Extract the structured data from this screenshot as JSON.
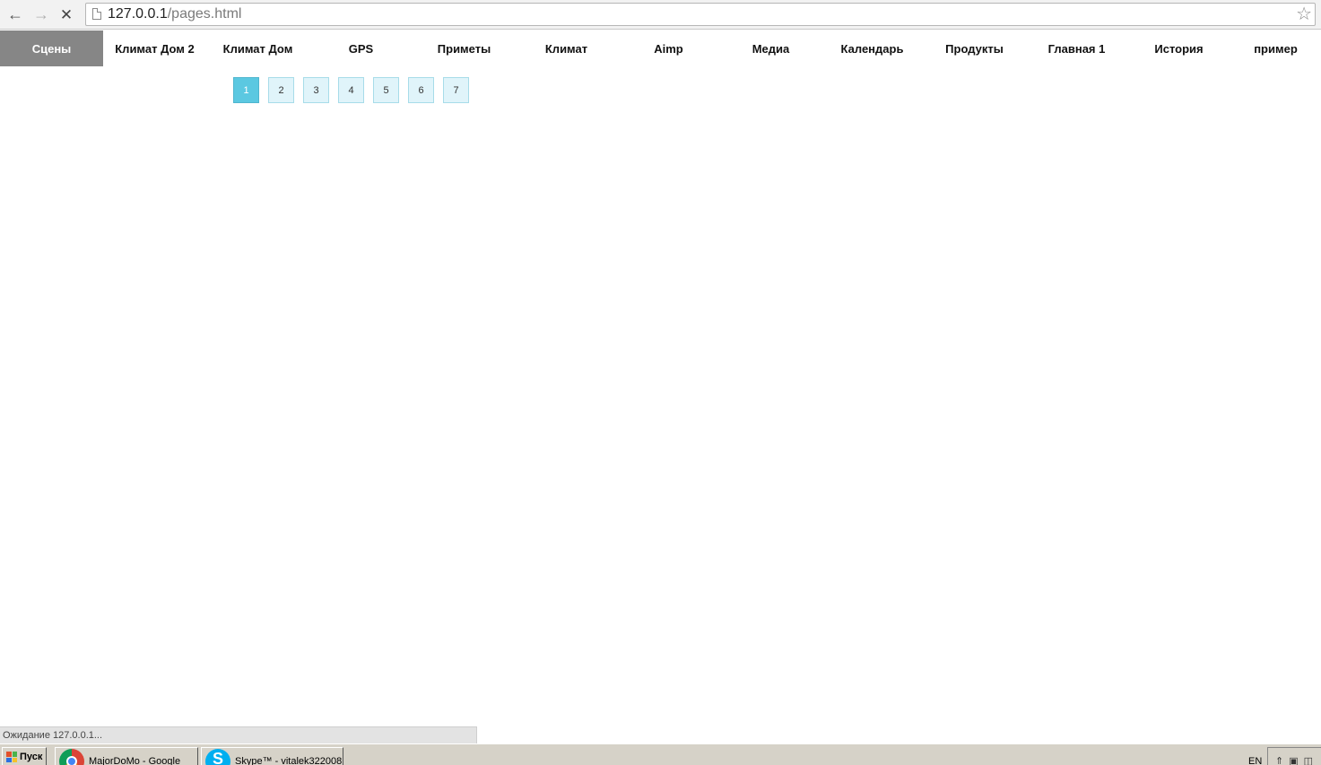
{
  "browser": {
    "url_host": "127.0.0.1",
    "url_path": "/pages.html",
    "back_icon": "←",
    "forward_icon": "→",
    "stop_icon": "✕",
    "star_icon": "☆"
  },
  "sitenav": {
    "items": [
      {
        "label": "Сцены",
        "active": true
      },
      {
        "label": "Климат Дом 2"
      },
      {
        "label": "Климат Дом"
      },
      {
        "label": "GPS"
      },
      {
        "label": "Приметы"
      },
      {
        "label": "Климат"
      },
      {
        "label": "Aimp"
      },
      {
        "label": "Медиа"
      },
      {
        "label": "Календарь"
      },
      {
        "label": "Продукты"
      },
      {
        "label": "Главная 1"
      },
      {
        "label": "История"
      },
      {
        "label": "пример"
      }
    ]
  },
  "pager": {
    "pages": [
      "1",
      "2",
      "3",
      "4",
      "5",
      "6",
      "7"
    ],
    "current": "1"
  },
  "status": {
    "text": "Ожидание 127.0.0.1..."
  },
  "taskbar": {
    "start_label": "Пуск",
    "tasks": [
      {
        "label": "MajorDoMo - Google",
        "icon": "chrome-icon"
      },
      {
        "label": "Skype™ - vitalek322008",
        "icon": "skype-icon"
      }
    ],
    "language": "EN"
  },
  "colors": {
    "nav_active_bg": "#868686",
    "pager_active_bg": "#5bc8e1",
    "pager_bg": "#e0f4fa"
  }
}
